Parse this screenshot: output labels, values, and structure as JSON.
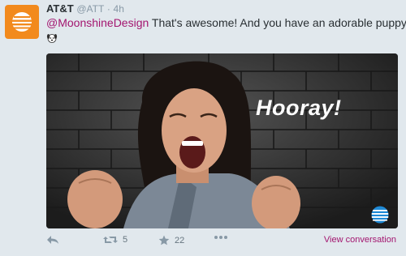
{
  "tweet": {
    "author_name": "AT&T",
    "author_handle": "@ATT",
    "separator": "·",
    "time": "4h",
    "mention": "@MoonshineDesign",
    "body": "That's awesome! And you have an adorable puppy!",
    "emoji": "dog-face",
    "media": {
      "overlay_text": "Hooray!",
      "brand": "att-globe-icon"
    },
    "actions": {
      "retweet_count": "5",
      "favorite_count": "22",
      "view_conversation": "View conversation"
    }
  },
  "colors": {
    "brand_orange": "#f28a1d",
    "link_magenta": "#a3156f",
    "muted": "#8899a6",
    "background": "#e1e8ed"
  }
}
